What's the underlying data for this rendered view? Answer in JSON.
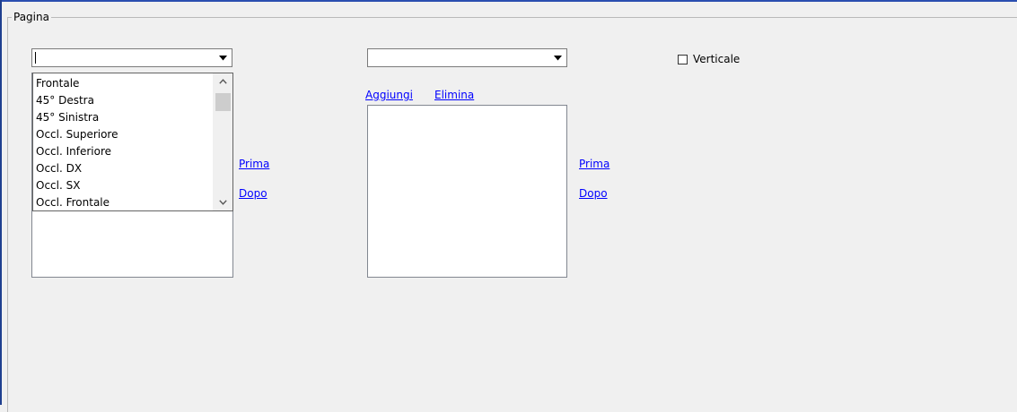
{
  "groupbox": {
    "title": "Pagina"
  },
  "left": {
    "combo_value": "",
    "dropdown_items": [
      "Frontale",
      "45° Destra",
      "45° Sinistra",
      "Occl. Superiore",
      "Occl. Inferiore",
      "Occl. DX",
      "Occl. SX",
      "Occl. Frontale"
    ],
    "prima_label": "Prima",
    "dopo_label": "Dopo"
  },
  "right": {
    "combo_value": "",
    "add_label": "Aggiungi",
    "delete_label": "Elimina",
    "list_items": [],
    "prima_label": "Prima",
    "dopo_label": "Dopo"
  },
  "vertical_checkbox": {
    "label": "Verticale",
    "checked": false
  }
}
